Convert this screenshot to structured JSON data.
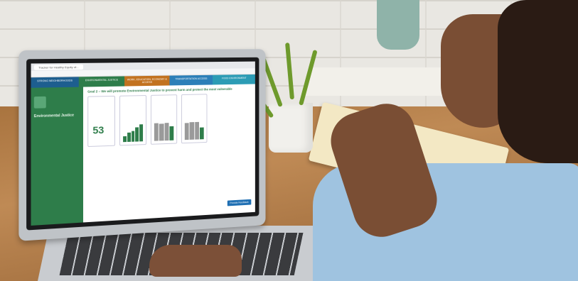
{
  "browser": {
    "tab_title": "Tracker for Healthy Equity of..."
  },
  "navbar": [
    {
      "label": "STRONG NEIGHBORHOODS",
      "color": "#1d5e8f"
    },
    {
      "label": "ENVIRONMENTAL JUSTICE",
      "color": "#2e7d4a"
    },
    {
      "label": "WORK, EDUCATION, ECONOMY & ACCESS",
      "color": "#c2721f"
    },
    {
      "label": "TRANSPORTATION ACCESS",
      "color": "#2c7fb8"
    },
    {
      "label": "FOOD ENVIRONMENT",
      "color": "#2c9cb5"
    }
  ],
  "sidebar": {
    "title": "Environmental Justice"
  },
  "main": {
    "goal_heading": "Goal 2 – We will promote Environmental Justice to prevent harm and protect the most vulnerable",
    "big_number": "53",
    "button_label": "Provide Feedback"
  },
  "colors": {
    "accent_green": "#2e7d4a",
    "button_blue": "#1f6fb3"
  }
}
